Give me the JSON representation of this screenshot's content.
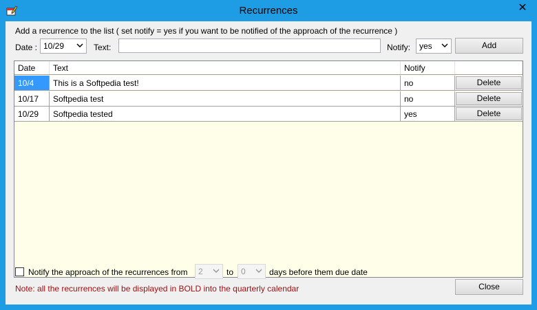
{
  "window": {
    "title": "Recurrences",
    "close_glyph": "✕"
  },
  "form": {
    "instruction": "Add a recurrence to the list ( set notify = yes if you want to be notified of the approach of the recurrence )",
    "date_label": "Date :",
    "date_value": "10/29",
    "text_label": "Text:",
    "text_value": "",
    "notify_label": "Notify:",
    "notify_value": "yes",
    "add_label": "Add"
  },
  "table": {
    "columns": [
      "Date",
      "Text",
      "Notify",
      ""
    ],
    "rows": [
      {
        "date": "10/4",
        "text": "This is a Softpedia test!",
        "notify": "no",
        "action": "Delete"
      },
      {
        "date": "10/17",
        "text": "Softpedia test",
        "notify": "no",
        "action": "Delete"
      },
      {
        "date": "10/29",
        "text": "Softpedia tested",
        "notify": "yes",
        "action": "Delete"
      }
    ]
  },
  "footer": {
    "notify_text_before": "Notify the approach of the recurrences from",
    "from_value": "2",
    "to_label": "to",
    "to_value": "0",
    "notify_text_after": "days before them due date",
    "note": "Note: all the recurrences will be displayed in BOLD into the quarterly calendar",
    "close_label": "Close"
  },
  "colors": {
    "titlebar": "#1f9de4",
    "selection": "#3399ff",
    "note": "#a01010",
    "grid_bg": "#fefee9"
  },
  "icons": {
    "app": "calendar-pencil-icon",
    "close": "close-icon",
    "dropdown": "chevron-down-icon"
  }
}
